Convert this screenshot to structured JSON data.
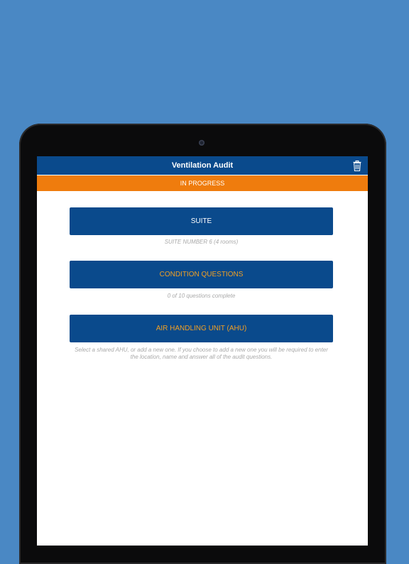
{
  "app": {
    "title": "Ventilation Audit",
    "status": "IN PROGRESS"
  },
  "icons": {
    "delete": "trash-icon"
  },
  "sections": {
    "suite": {
      "label": "SUITE",
      "helper": "SUITE NUMBER 6 (4 rooms)"
    },
    "condition": {
      "label": "CONDITION QUESTIONS",
      "helper": "0 of 10 questions complete"
    },
    "ahu": {
      "label": "AIR HANDLING UNIT (AHU)",
      "helper": "Select a shared AHU, or add a new one. If you choose to add a new one you will be required to enter the location, name and answer all of the audit questions."
    }
  },
  "colors": {
    "background": "#4a88c4",
    "primary": "#0a4a8c",
    "status_orange": "#ef7c0d",
    "accent_text": "#f2a024",
    "helper_text": "#a9a9a9"
  }
}
